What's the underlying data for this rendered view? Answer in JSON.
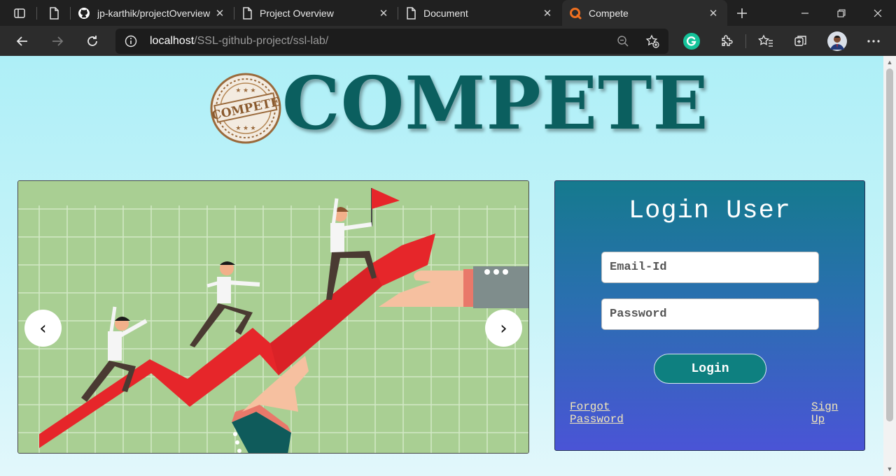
{
  "tabs": [
    {
      "title": "jp-karthik/projectOverview",
      "icon": "github-icon",
      "active": false
    },
    {
      "title": "Project Overview",
      "icon": "page-icon",
      "active": false
    },
    {
      "title": "Document",
      "icon": "page-icon",
      "active": false
    },
    {
      "title": "Compete",
      "icon": "compete-favicon",
      "active": true
    }
  ],
  "address": {
    "host": "localhost",
    "path": "/SSL-github-project/ssl-lab/"
  },
  "logo": {
    "seal_text": "COMPETE",
    "wordmark": "COMPETE"
  },
  "carousel": {
    "prev_glyph": "‹",
    "next_glyph": "›"
  },
  "login": {
    "title": "Login User",
    "email_placeholder": "Email-Id",
    "password_placeholder": "Password",
    "button": "Login",
    "forgot_line1": "Forgot",
    "forgot_line2": "Password",
    "signup_line1": "Sign",
    "signup_line2": "Up"
  },
  "colors": {
    "wordmark": "#0b5f5f",
    "login_button": "#0e8080",
    "link": "#f3e7b8"
  }
}
